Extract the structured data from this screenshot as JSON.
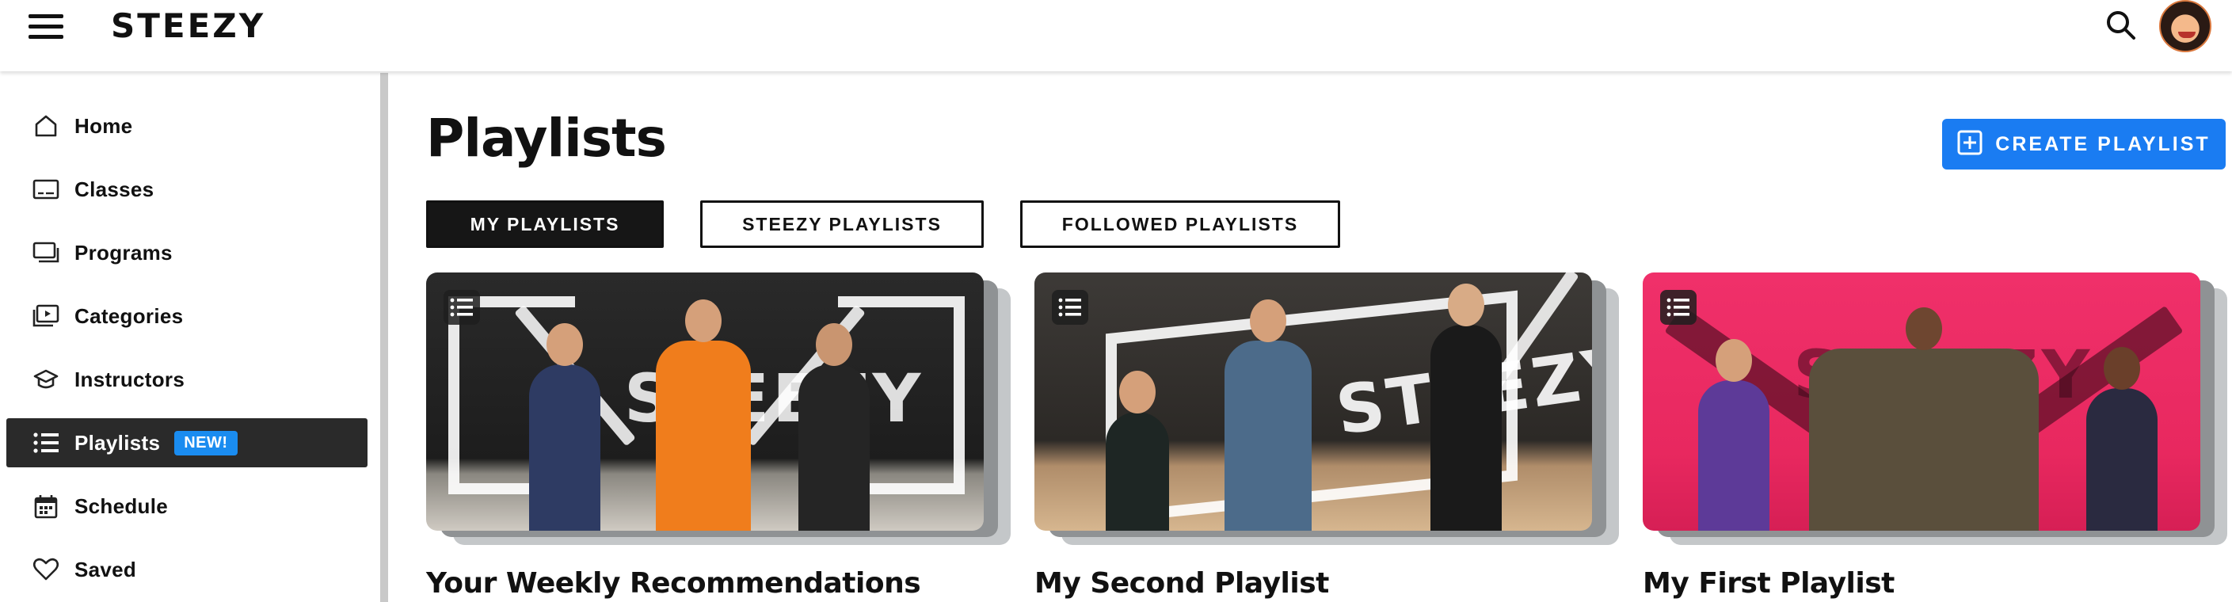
{
  "header": {
    "logo": "STEEZY"
  },
  "sidebar": {
    "items": [
      {
        "label": "Home",
        "icon": "home-icon"
      },
      {
        "label": "Classes",
        "icon": "classes-icon"
      },
      {
        "label": "Programs",
        "icon": "programs-icon"
      },
      {
        "label": "Categories",
        "icon": "categories-icon"
      },
      {
        "label": "Instructors",
        "icon": "instructors-icon"
      },
      {
        "label": "Playlists",
        "icon": "list-icon",
        "badge": "NEW!",
        "active": true
      },
      {
        "label": "Schedule",
        "icon": "calendar-icon"
      },
      {
        "label": "Saved",
        "icon": "heart-icon"
      }
    ]
  },
  "main": {
    "title": "Playlists",
    "create_button": "CREATE PLAYLIST",
    "tabs": [
      {
        "label": "MY PLAYLISTS",
        "active": true
      },
      {
        "label": "STEEZY PLAYLISTS",
        "active": false
      },
      {
        "label": "FOLLOWED PLAYLISTS",
        "active": false
      }
    ],
    "playlists": [
      {
        "title": "Your Weekly Recommendations",
        "thumb_watermark": "STEEZY"
      },
      {
        "title": "My Second Playlist",
        "thumb_watermark": "STEEZY"
      },
      {
        "title": "My First Playlist",
        "thumb_watermark": "STEEZY"
      }
    ]
  },
  "colors": {
    "accent": "#1a7cf2",
    "badge": "#1a8cf0",
    "active_nav": "#2a2a2a",
    "card3_background": "#f0306a"
  }
}
